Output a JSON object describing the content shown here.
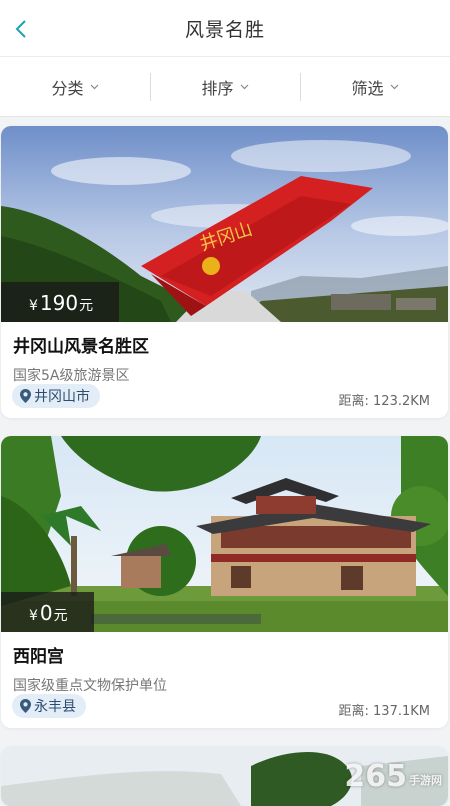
{
  "header": {
    "title": "风景名胜"
  },
  "filters": [
    {
      "label": "分类"
    },
    {
      "label": "排序"
    },
    {
      "label": "筛选"
    }
  ],
  "cards": [
    {
      "image": "井冈山雕塑",
      "image_text": "井冈山",
      "price_currency": "¥",
      "price_value": "190",
      "price_unit": "元",
      "name": "井冈山风景名胜区",
      "description": "国家5A级旅游景区",
      "location": "井冈山市",
      "distance": "距离: 123.2KM"
    },
    {
      "image": "西阳宫建筑",
      "price_currency": "¥",
      "price_value": "0",
      "price_unit": "元",
      "name": "西阳宫",
      "description": "国家级重点文物保护单位",
      "location": "永丰县",
      "distance": "距离: 137.1KM"
    },
    {
      "image": "山景"
    }
  ],
  "watermark": {
    "text": "265",
    "suffix": "手游网"
  },
  "colors": {
    "accent": "#1ba3b3",
    "price_bg": "#1a1a1a",
    "tag_bg": "#e3edf7"
  },
  "icons": {
    "back": "chevron-left-icon",
    "dropdown": "chevron-down-icon",
    "location": "map-pin-icon"
  }
}
